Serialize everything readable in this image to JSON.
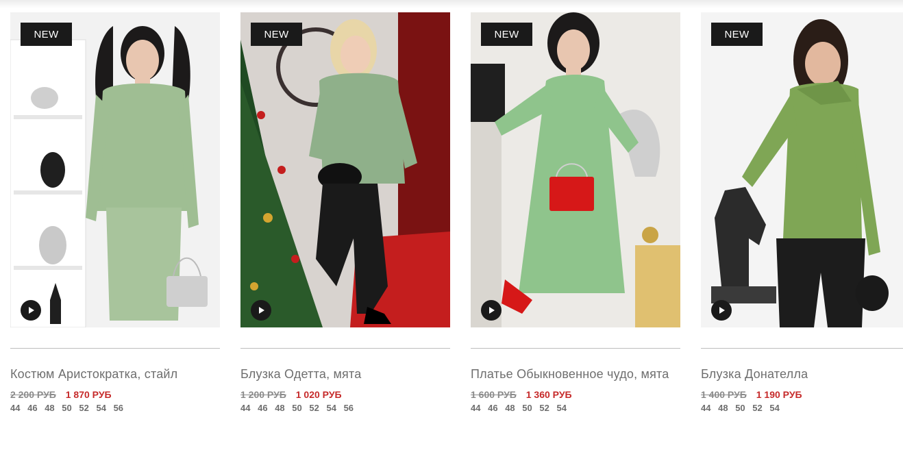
{
  "products": [
    {
      "badge": "NEW",
      "title": "Костюм Аристократка, стайл",
      "old_price": "2 200 РУБ",
      "new_price": "1 870 РУБ",
      "sizes": [
        "44",
        "46",
        "48",
        "50",
        "52",
        "54",
        "56"
      ],
      "colors": {
        "background": "#f2f2f2",
        "garment": "#9fbe93",
        "hair": "#1c1a1a"
      },
      "image_icon": "model-photo-suit"
    },
    {
      "badge": "NEW",
      "title": "Блузка Одетта, мята",
      "old_price": "1 200 РУБ",
      "new_price": "1 020 РУБ",
      "sizes": [
        "44",
        "46",
        "48",
        "50",
        "52",
        "54",
        "56"
      ],
      "colors": {
        "background": "#d8d3cf",
        "garment": "#8fb08a",
        "hair": "#e8d6a8"
      },
      "image_icon": "model-photo-blouse"
    },
    {
      "badge": "NEW",
      "title": "Платье Обыкновенное чудо, мята",
      "old_price": "1 600 РУБ",
      "new_price": "1 360 РУБ",
      "sizes": [
        "44",
        "46",
        "48",
        "50",
        "52",
        "54"
      ],
      "colors": {
        "background": "#eceae6",
        "garment": "#8fc48c",
        "hair": "#1c1a1a"
      },
      "image_icon": "model-photo-dress"
    },
    {
      "badge": "NEW",
      "title": "Блузка Донателла",
      "old_price": "1 400 РУБ",
      "new_price": "1 190 РУБ",
      "sizes": [
        "44",
        "48",
        "50",
        "52",
        "54"
      ],
      "colors": {
        "background": "#f4f4f4",
        "garment": "#7fa655",
        "hair": "#2a1d17"
      },
      "image_icon": "model-photo-top"
    }
  ]
}
